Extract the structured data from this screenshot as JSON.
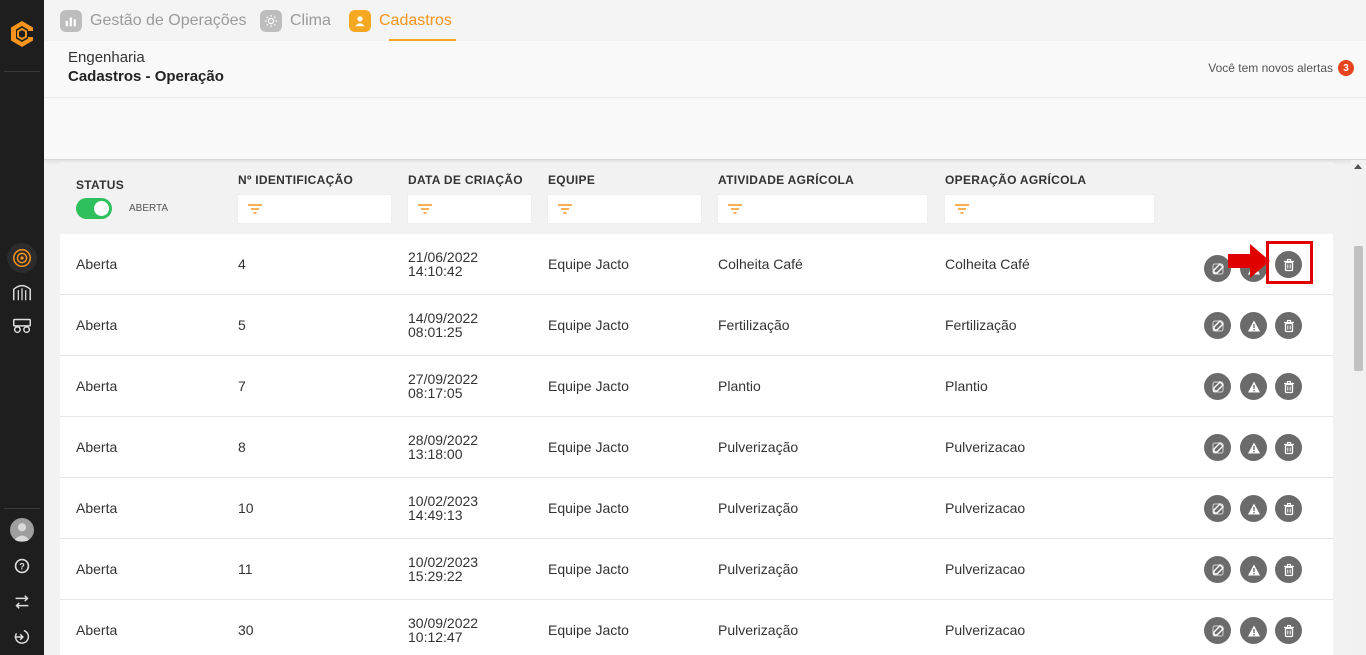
{
  "tabs": [
    {
      "label": "Gestão de Operações",
      "icon": "chart-icon",
      "active": false
    },
    {
      "label": "Clima",
      "icon": "sun-icon",
      "active": false
    },
    {
      "label": "Cadastros",
      "icon": "user-icon",
      "active": true
    }
  ],
  "header": {
    "breadcrumb_parent": "Engenharia",
    "breadcrumb_current": "Cadastros - Operação",
    "alerts_text": "Você tem novos alertas",
    "alerts_count": "3"
  },
  "table": {
    "columns": [
      "STATUS",
      "Nº IDENTIFICAÇÃO",
      "DATA DE CRIAÇÃO",
      "EQUIPE",
      "ATIVIDADE AGRÍCOLA",
      "OPERAÇÃO AGRÍCOLA"
    ],
    "status_toggle_label": "ABERTA",
    "rows": [
      {
        "status": "Aberta",
        "id": "4",
        "date": "21/06/2022",
        "time": "14:10:42",
        "team": "Equipe Jacto",
        "activity": "Colheita Café",
        "operation": "Colheita Café"
      },
      {
        "status": "Aberta",
        "id": "5",
        "date": "14/09/2022",
        "time": "08:01:25",
        "team": "Equipe Jacto",
        "activity": "Fertilização",
        "operation": "Fertilização"
      },
      {
        "status": "Aberta",
        "id": "7",
        "date": "27/09/2022",
        "time": "08:17:05",
        "team": "Equipe Jacto",
        "activity": "Plantio",
        "operation": "Plantio"
      },
      {
        "status": "Aberta",
        "id": "8",
        "date": "28/09/2022",
        "time": "13:18:00",
        "team": "Equipe Jacto",
        "activity": "Pulverização",
        "operation": "Pulverizacao"
      },
      {
        "status": "Aberta",
        "id": "10",
        "date": "10/02/2023",
        "time": "14:49:13",
        "team": "Equipe Jacto",
        "activity": "Pulverização",
        "operation": "Pulverizacao"
      },
      {
        "status": "Aberta",
        "id": "11",
        "date": "10/02/2023",
        "time": "15:29:22",
        "team": "Equipe Jacto",
        "activity": "Pulverização",
        "operation": "Pulverizacao"
      },
      {
        "status": "Aberta",
        "id": "30",
        "date": "30/09/2022",
        "time": "10:12:47",
        "team": "Equipe Jacto",
        "activity": "Pulverização",
        "operation": "Pulverizacao"
      }
    ]
  },
  "colors": {
    "accent": "#f7a823",
    "sidebar": "#1e1e1e",
    "toggle_on": "#2ec05c",
    "badge": "#e8431f",
    "highlight": "#e00000",
    "action_button": "#6b6b6b"
  },
  "icons": {
    "row_actions": [
      "edit-icon",
      "warning-icon",
      "trash-icon"
    ],
    "sidebar": [
      "target-icon",
      "silo-icon",
      "machine-icon",
      "avatar",
      "help-icon",
      "swap-icon",
      "logout-icon"
    ]
  }
}
